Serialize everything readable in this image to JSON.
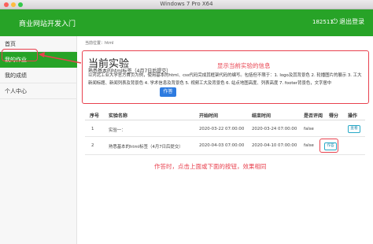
{
  "window": {
    "title": "Windows 7 Pro X64"
  },
  "header": {
    "brand": "商业网站开发入门",
    "user_id": "182511",
    "logout_label": "退出登录",
    "logout_icon": "power-icon"
  },
  "sidebar": {
    "items": [
      {
        "label": "首页",
        "active": false
      },
      {
        "label": "我的作业",
        "active": true
      },
      {
        "label": "我的成绩",
        "active": false
      },
      {
        "label": "个人中心",
        "active": false
      }
    ]
  },
  "breadcrumb": "当前位置：html",
  "current": {
    "heading": "当前实验",
    "name": "熟悉基本的html标签（4月7日后提交）",
    "description": "以河北工业大学官方首页为例，使用基本的html、css代码完成其框架代码的编写。包括但不限于：1. logo及其背景色 2. 轮播图片的展示 3. 工大新闻标题、新闻列表及背景色 4. 学术信息及背景色 5. 视频工大及背景色 6. 站点地图高度、列表高度 7. footer背景色，文字居中",
    "button": "作答"
  },
  "annotations": {
    "top": "显示当前实验的信息",
    "bottom": "作答时，点击上面或下面的按钮，效果相同"
  },
  "table": {
    "headers": [
      "序号",
      "实验名称",
      "开始时间",
      "结束时间",
      "是否评阅",
      "得分",
      "操作"
    ],
    "rows": [
      {
        "idx": "1",
        "name": "实验一：",
        "start": "2020-03-22 07:00:00",
        "end": "2020-03-24 07:00:00",
        "reviewed": "false",
        "score": "",
        "action": "查看"
      },
      {
        "idx": "2",
        "name": "熟悉基本的html标签（4月7日后提交）",
        "start": "2020-04-03 07:00:00",
        "end": "2020-04-10 07:00:00",
        "reviewed": "false",
        "score": "",
        "action": "作答"
      }
    ]
  },
  "colors": {
    "header_green": "#27a327",
    "annotation_red": "#e8424f",
    "primary_blue": "#2d7be0"
  }
}
